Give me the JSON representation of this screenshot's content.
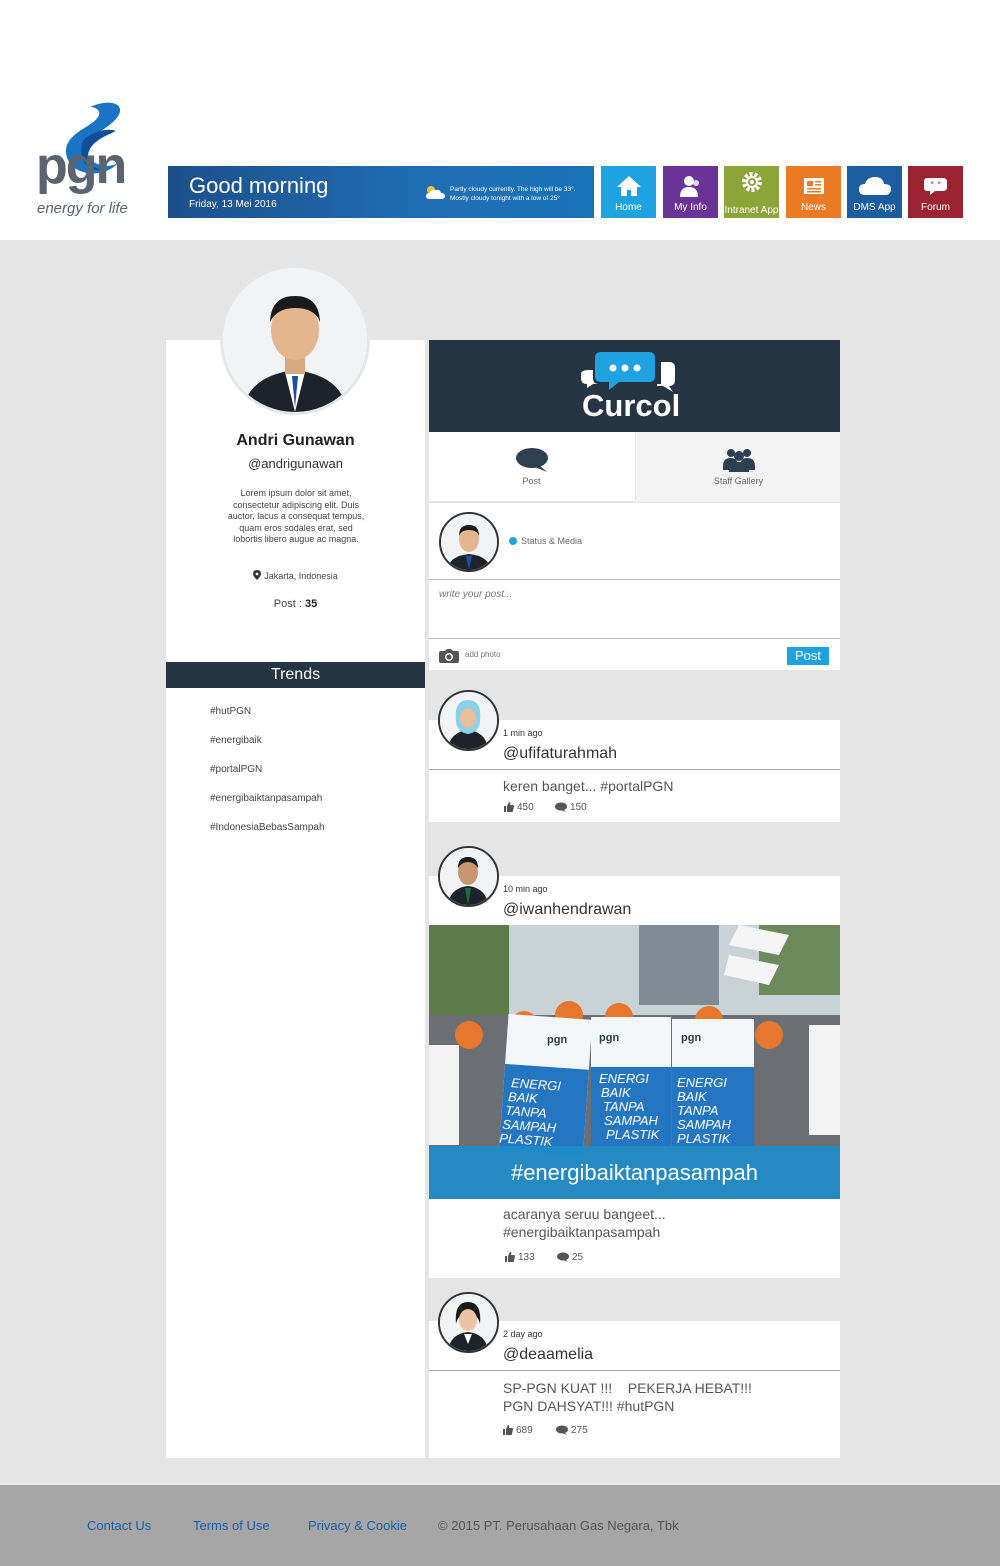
{
  "brand": {
    "name": "pgn",
    "tagline": "energy for life",
    "color_dark": "#5a6370",
    "color_accent": "#1a72b8"
  },
  "greeting": {
    "title": "Good morning",
    "date": "Friday, 13 Mei 2016",
    "weather_line1": "Partly cloudy currently. The high will be 33°.",
    "weather_line2": "Mostly cloudy tonight with a low of 25°",
    "weather_icon": "partly-cloudy-icon"
  },
  "nav": [
    {
      "label": "Home",
      "icon": "home-icon",
      "color": "#1fa2e0"
    },
    {
      "label": "My Info",
      "icon": "users-icon",
      "color": "#6a3397"
    },
    {
      "label": "Intranet App",
      "icon": "gear-icon",
      "color": "#8ca539"
    },
    {
      "label": "News",
      "icon": "newspaper-icon",
      "color": "#ea7a23"
    },
    {
      "label": "DMS App",
      "icon": "cloud-icon",
      "color": "#1b5d9e"
    },
    {
      "label": "Forum",
      "icon": "chat-icon",
      "color": "#9a2431"
    }
  ],
  "profile": {
    "name": "Andri Gunawan",
    "handle": "@andrigunawan",
    "bio": "Lorem ipsum dolor sit amet, consectetur adipiscing elit. Duis auctor, lacus a consequat tempus, quam eros sodales erat, sed lobortis libero augue ac magna.",
    "location": "Jakarta, Indonesia",
    "post_label": "Post",
    "post_sep": " : ",
    "post_count": "35"
  },
  "trends": {
    "title": "Trends",
    "items": [
      "#hutPGN",
      "#energibaik",
      "#portalPGN",
      "#energibaiktanpasampah",
      "#IndonesiaBebasSampah"
    ]
  },
  "curcol": {
    "title": "Curcol",
    "tabs": [
      {
        "label": "Post",
        "icon": "speech-bubble-icon"
      },
      {
        "label": "Staff Gallery",
        "icon": "group-icon"
      }
    ],
    "composer": {
      "status_label": "Status & Media",
      "placeholder": "write your post...",
      "add_photo": "add photo",
      "post_button": "Post"
    }
  },
  "posts": [
    {
      "time": "1 min ago",
      "user": "@ufifaturahmah",
      "text": "keren banget... #portalPGN",
      "likes": "450",
      "comments": "150"
    },
    {
      "time": "10 min ago",
      "user": "@iwanhendrawan",
      "image_caption": "#energibaiktanpasampah",
      "sign_text": [
        "ENERGI",
        "BAIK",
        "TANPA",
        "SAMPAH",
        "PLASTIK"
      ],
      "sign_logo": "pgn",
      "text_line1": "acaranya seruu bangeet...",
      "text_line2": "#energibaiktanpasampah",
      "likes": "133",
      "comments": "25"
    },
    {
      "time": "2 day ago",
      "user": "@deaamelia",
      "text_line1": "SP-PGN KUAT !!!    PEKERJA HEBAT!!!",
      "text_line2": "PGN DAHSYAT!!! #hutPGN",
      "likes": "689",
      "comments": "275"
    }
  ],
  "footer": {
    "links": [
      "Contact Us",
      "Terms of Use",
      "Privacy & Cookie"
    ],
    "copyright": "© 2015 PT. Perusahaan Gas Negara, Tbk"
  }
}
